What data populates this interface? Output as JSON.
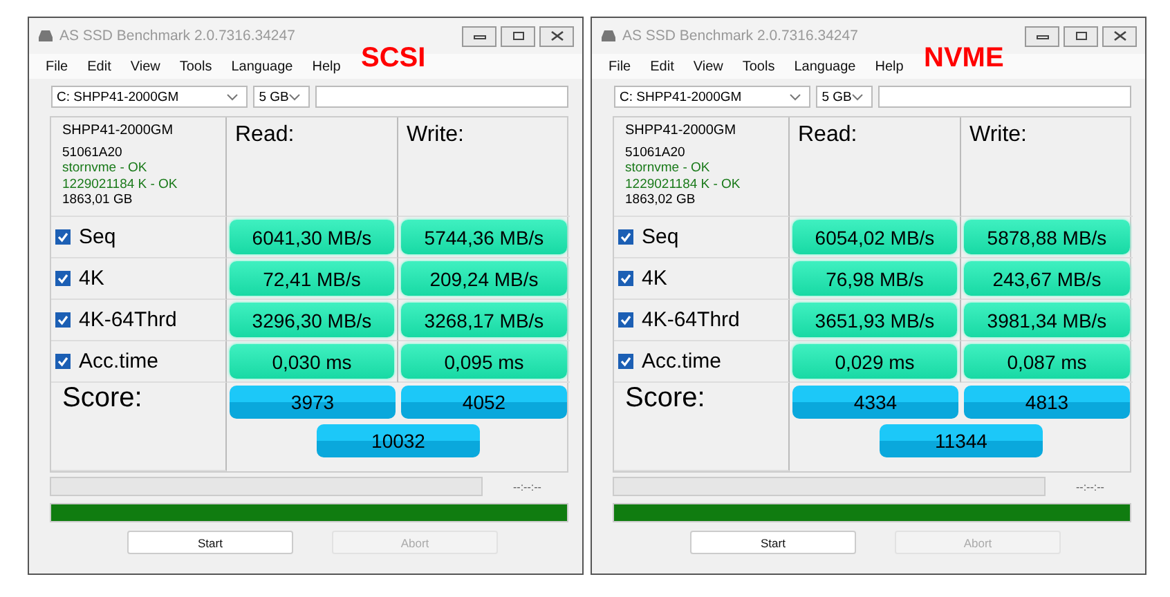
{
  "windows": [
    {
      "title": "AS SSD Benchmark 2.0.7316.34247",
      "overlay_label": "SCSI",
      "menu": [
        "File",
        "Edit",
        "View",
        "Tools",
        "Language",
        "Help"
      ],
      "drive": "C: SHPP41-2000GM",
      "size": "5 GB",
      "info": [
        {
          "text": "SHPP41-2000GM",
          "ok": false
        },
        {
          "text": "51061A20",
          "ok": false
        },
        {
          "text": "stornvme - OK",
          "ok": true
        },
        {
          "text": "1229021184 K - OK",
          "ok": true
        },
        {
          "text": "1863,01 GB",
          "ok": false
        }
      ],
      "read_header": "Read:",
      "write_header": "Write:",
      "rows": [
        {
          "name": "Seq",
          "checked": true,
          "read": "6041,30 MB/s",
          "write": "5744,36 MB/s"
        },
        {
          "name": "4K",
          "checked": true,
          "read": "72,41 MB/s",
          "write": "209,24 MB/s"
        },
        {
          "name": "4K-64Thrd",
          "checked": true,
          "read": "3296,30 MB/s",
          "write": "3268,17 MB/s"
        },
        {
          "name": "Acc.time",
          "checked": true,
          "read": "0,030 ms",
          "write": "0,095 ms"
        }
      ],
      "score_label": "Score:",
      "score_read": "3973",
      "score_write": "4052",
      "score_total": "10032",
      "time": "--:--:--",
      "status_bar": {
        "level": 1
      },
      "start_button": {
        "label": "Start",
        "disabled": false
      },
      "abort_button": {
        "label": "Abort",
        "disabled": true
      }
    },
    {
      "title": "AS SSD Benchmark 2.0.7316.34247",
      "overlay_label": "NVME",
      "menu": [
        "File",
        "Edit",
        "View",
        "Tools",
        "Language",
        "Help"
      ],
      "drive": "C: SHPP41-2000GM",
      "size": "5 GB",
      "info": [
        {
          "text": "SHPP41-2000GM",
          "ok": false
        },
        {
          "text": "51061A20",
          "ok": false
        },
        {
          "text": "stornvme - OK",
          "ok": true
        },
        {
          "text": "1229021184 K - OK",
          "ok": true
        },
        {
          "text": "1863,02 GB",
          "ok": false
        }
      ],
      "read_header": "Read:",
      "write_header": "Write:",
      "rows": [
        {
          "name": "Seq",
          "checked": true,
          "read": "6054,02 MB/s",
          "write": "5878,88 MB/s"
        },
        {
          "name": "4K",
          "checked": true,
          "read": "76,98 MB/s",
          "write": "243,67 MB/s"
        },
        {
          "name": "4K-64Thrd",
          "checked": true,
          "read": "3651,93 MB/s",
          "write": "3981,34 MB/s"
        },
        {
          "name": "Acc.time",
          "checked": true,
          "read": "0,029 ms",
          "write": "0,087 ms"
        }
      ],
      "score_label": "Score:",
      "score_read": "4334",
      "score_write": "4813",
      "score_total": "11344",
      "time": "--:--:--",
      "status_bar": {
        "level": 1
      },
      "start_button": {
        "label": "Start",
        "disabled": false
      },
      "abort_button": {
        "label": "Abort",
        "disabled": true
      }
    }
  ]
}
